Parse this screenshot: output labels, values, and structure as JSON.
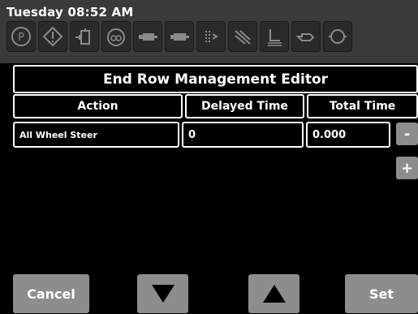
{
  "status": {
    "clock": "Tuesday 08:52 AM",
    "icons": [
      "parking-brake-icon",
      "warning-icon",
      "fuel-icon",
      "differential-lock-icon",
      "hydraulic-icon",
      "engine-icon",
      "spray-icon",
      "ventilation-icon",
      "seat-icon",
      "oil-can-icon",
      "coolant-icon"
    ]
  },
  "editor": {
    "title": "End Row Management Editor",
    "columns": {
      "action": "Action",
      "delayed": "Delayed Time",
      "total": "Total Time"
    },
    "rows": [
      {
        "action": "All Wheel Steer",
        "delayed": "0",
        "total": "0.000"
      }
    ],
    "minus_label": "-",
    "plus_label": "+"
  },
  "footer": {
    "cancel_label": "Cancel",
    "set_label": "Set"
  },
  "colors": {
    "bar": "#3a3a3a",
    "button": "#8d8d8d",
    "icon": "#8a8a8a"
  }
}
